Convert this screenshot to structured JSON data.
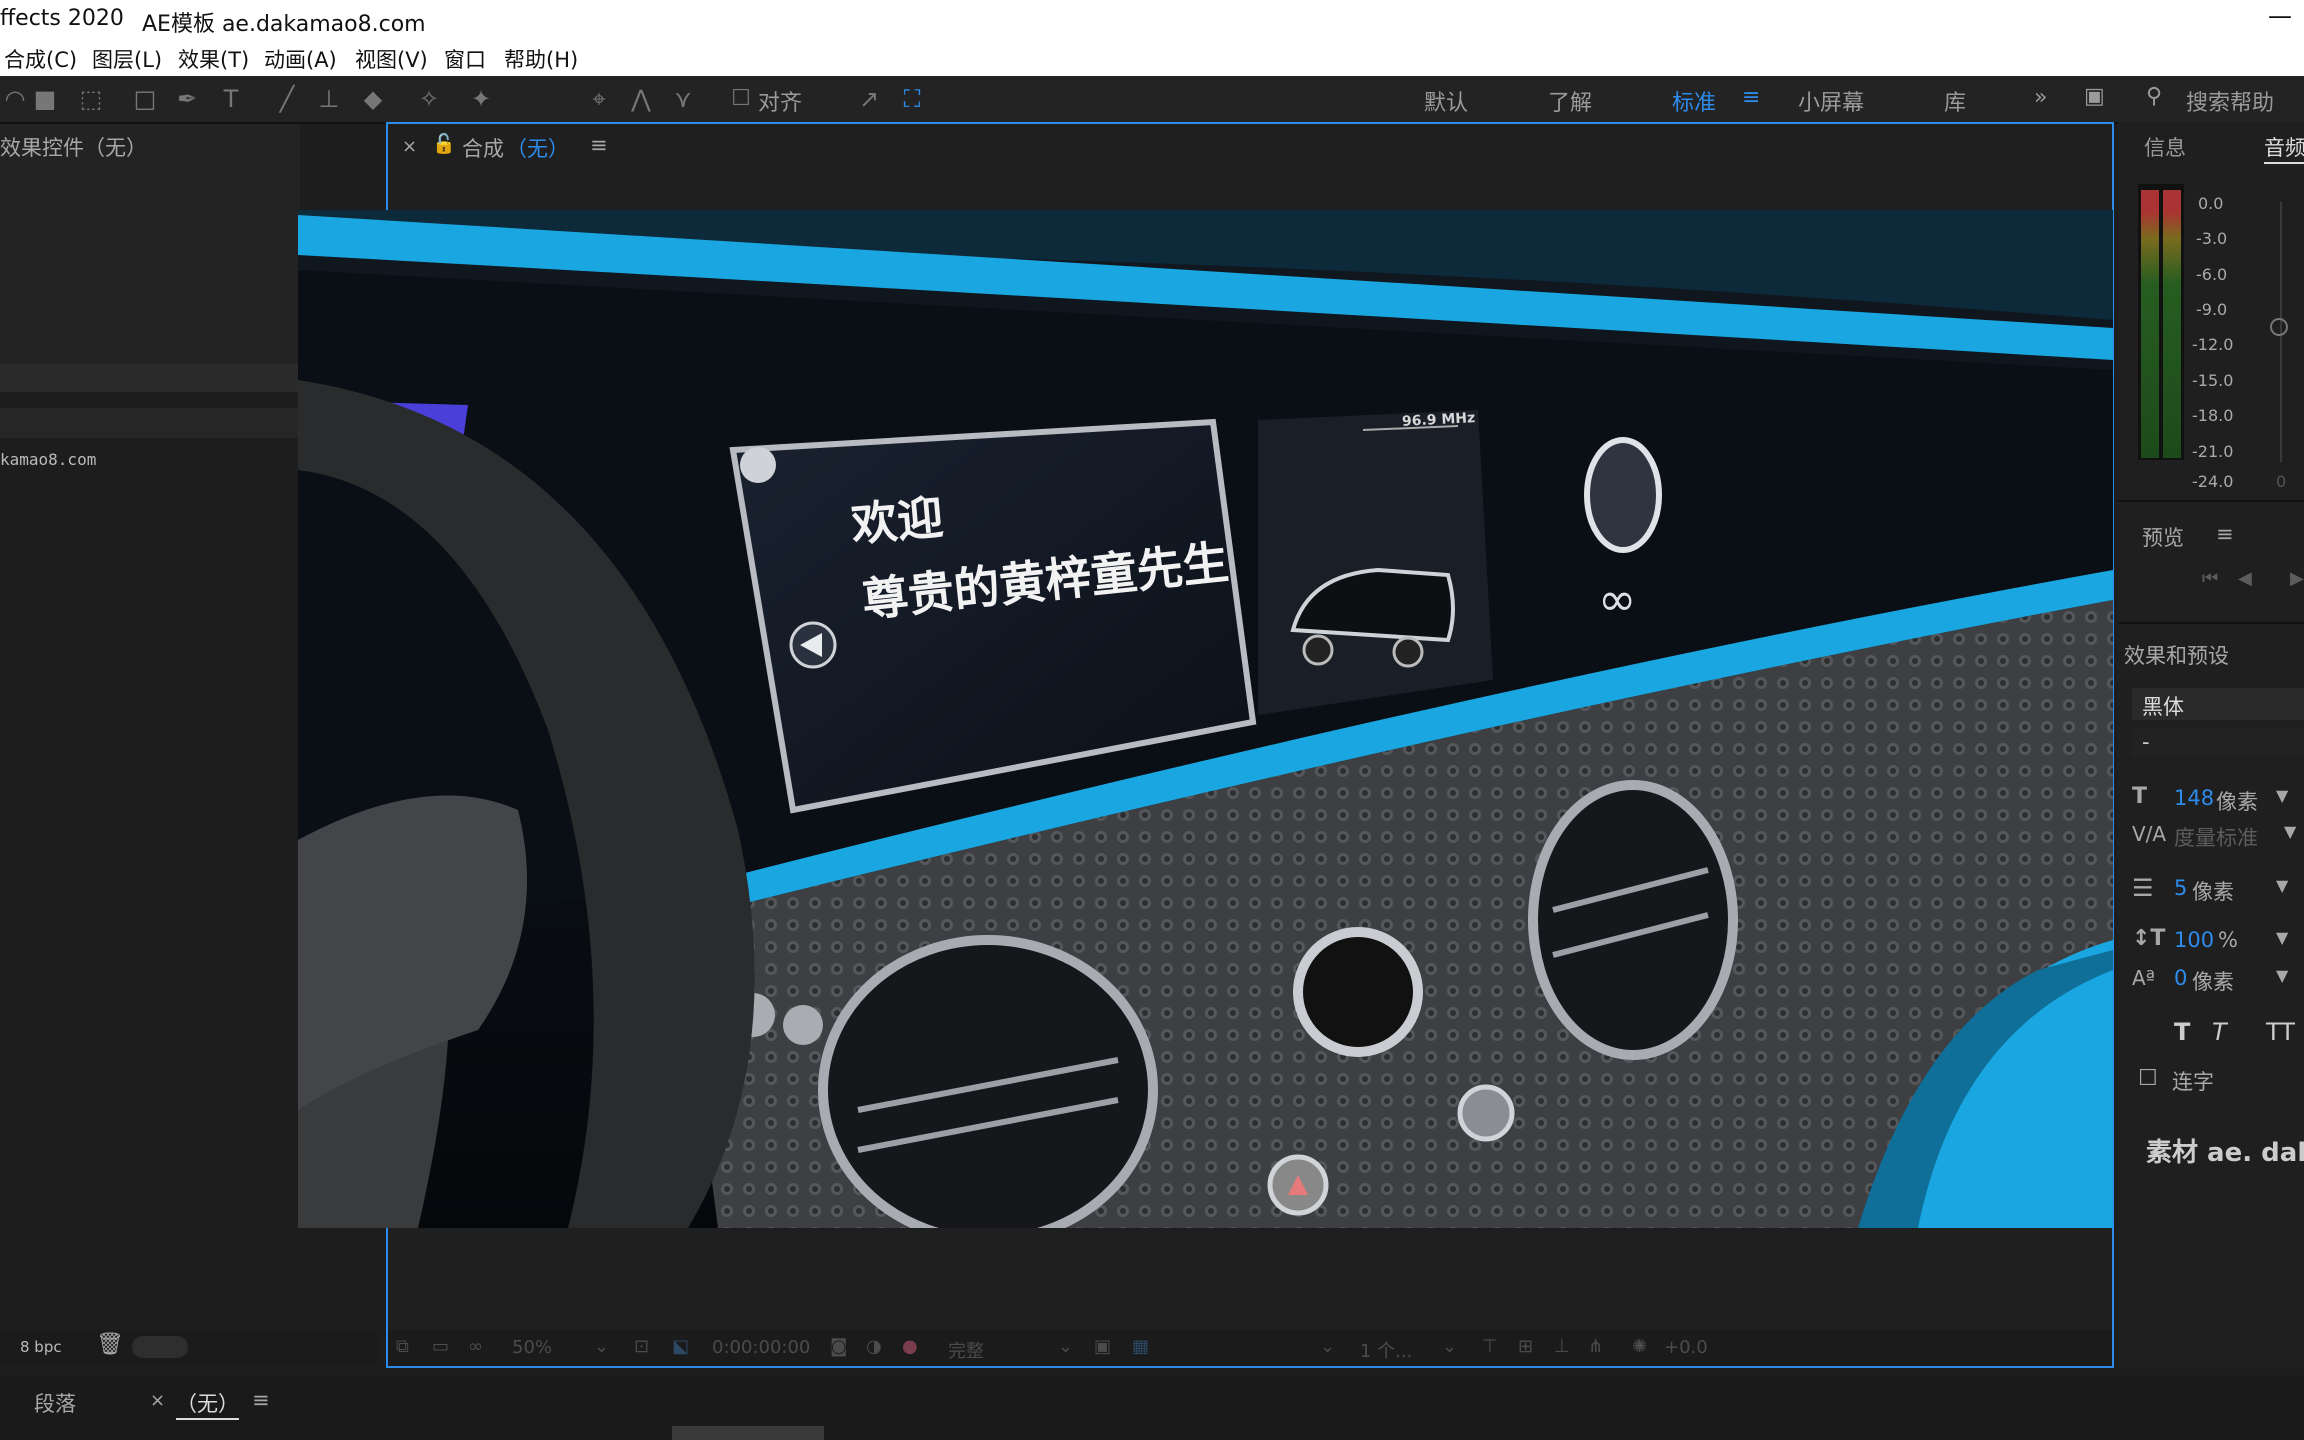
{
  "title": {
    "app": "ffects 2020",
    "site": "AE模板 ae.dakamao8.com"
  },
  "menu": [
    "合成(C)",
    "图层(L)",
    "效果(T)",
    "动画(A)",
    "视图(V)",
    "窗口",
    "帮助(H)"
  ],
  "toolbar": {
    "align_label": "对齐"
  },
  "workspaces": [
    "默认",
    "了解",
    "标准",
    "小屏幕",
    "库"
  ],
  "search": {
    "placeholder": "搜索帮助"
  },
  "left": {
    "effects_title": "效果控件（无）",
    "project_item": "kamao8.com",
    "bpc": "8 bpc"
  },
  "comp": {
    "tab_label": "合成",
    "tab_none": "（无）",
    "zoom": "50%",
    "timecode": "0:00:00:00",
    "resolution": "完整",
    "views": "1 个...",
    "exposure": "+0.0"
  },
  "video": {
    "welcome": "欢迎",
    "greeting": "尊贵的黄梓童先生",
    "radio": "96.9 MHz"
  },
  "right": {
    "info_tab": "信息",
    "audio_tab": "音频",
    "meter_ticks": [
      "0.0",
      "-3.0",
      "-6.0",
      "-9.0",
      "-12.0",
      "-15.0",
      "-18.0",
      "-21.0",
      "-24.0"
    ],
    "meter_zero": "0",
    "preview_title": "预览",
    "effects_presets": "效果和预设",
    "font": "黑体",
    "font_style": "-",
    "font_size": "148",
    "font_size_unit": "像素",
    "kerning": "度量标准",
    "leading": "5",
    "leading_unit": "像素",
    "vscale": "100",
    "vscale_unit": "%",
    "baseline": "0",
    "baseline_unit": "像素",
    "ligature_label": "连字",
    "footer_text": "素材 ae. dak"
  },
  "bottom": {
    "paragraph_tab": "段落",
    "tab_none": "（无）"
  },
  "colors": {
    "accent": "#2d8ceb",
    "background": "#1d1d1d",
    "dashboard_blue": "#1aa6e0"
  }
}
